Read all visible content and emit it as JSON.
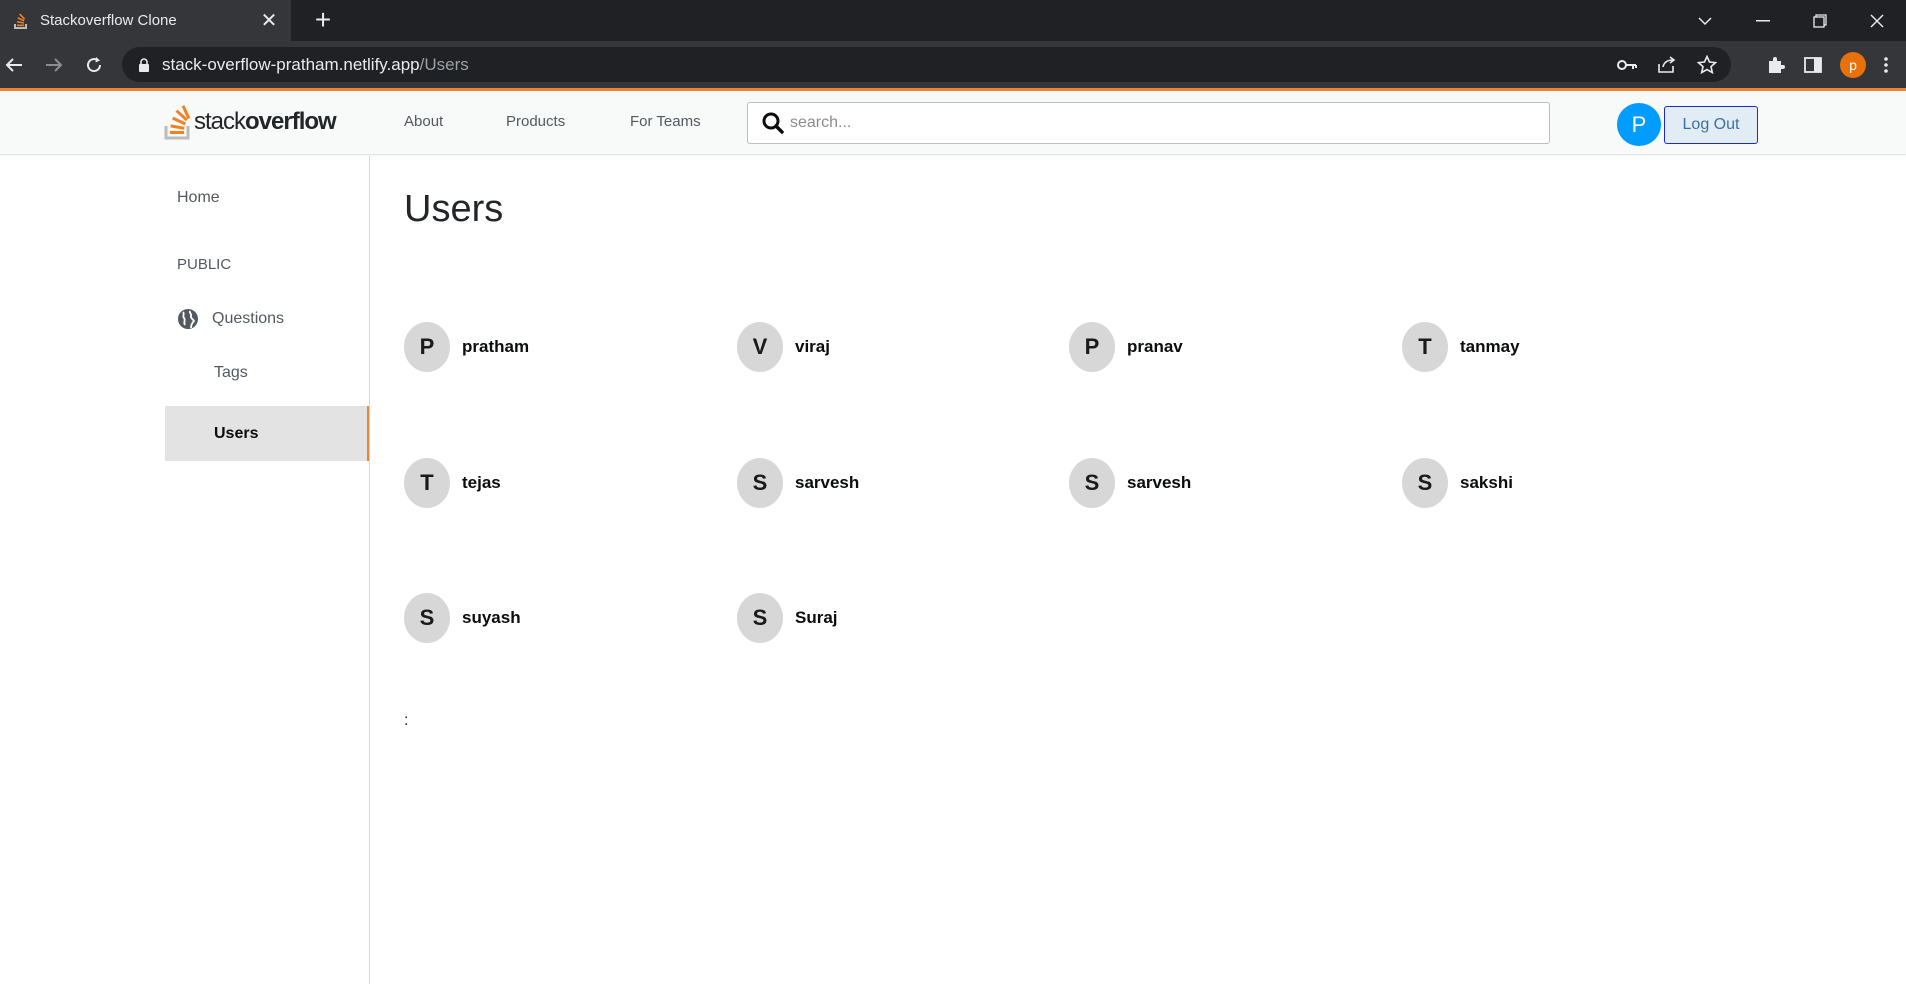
{
  "browser": {
    "tab_title": "Stackoverflow Clone",
    "tab_close": "✕",
    "new_tab": "+",
    "url_host": "stack-overflow-pratham.netlify.app",
    "url_path": "/Users",
    "profile_initial": "p"
  },
  "navbar": {
    "logo_part1": "stack",
    "logo_part2": "overflow",
    "links": [
      "About",
      "Products",
      "For Teams"
    ],
    "search_placeholder": "search...",
    "avatar_initial": "P",
    "logout_label": "Log Out"
  },
  "sidebar": {
    "home": "Home",
    "section": "PUBLIC",
    "questions": "Questions",
    "tags": "Tags",
    "users": "Users"
  },
  "main": {
    "title": "Users",
    "users": [
      {
        "initial": "P",
        "name": "pratham"
      },
      {
        "initial": "V",
        "name": "viraj"
      },
      {
        "initial": "P",
        "name": "pranav"
      },
      {
        "initial": "T",
        "name": "tanmay"
      },
      {
        "initial": "T",
        "name": "tejas"
      },
      {
        "initial": "S",
        "name": "sarvesh"
      },
      {
        "initial": "S",
        "name": "sarvesh"
      },
      {
        "initial": "S",
        "name": "sakshi"
      },
      {
        "initial": "S",
        "name": "suyash"
      },
      {
        "initial": "S",
        "name": "Suraj"
      }
    ],
    "footer_text": ":"
  },
  "colors": {
    "accent": "#ef8236",
    "avatar_blue": "#009dff",
    "active_bg": "#e3e3e3"
  }
}
